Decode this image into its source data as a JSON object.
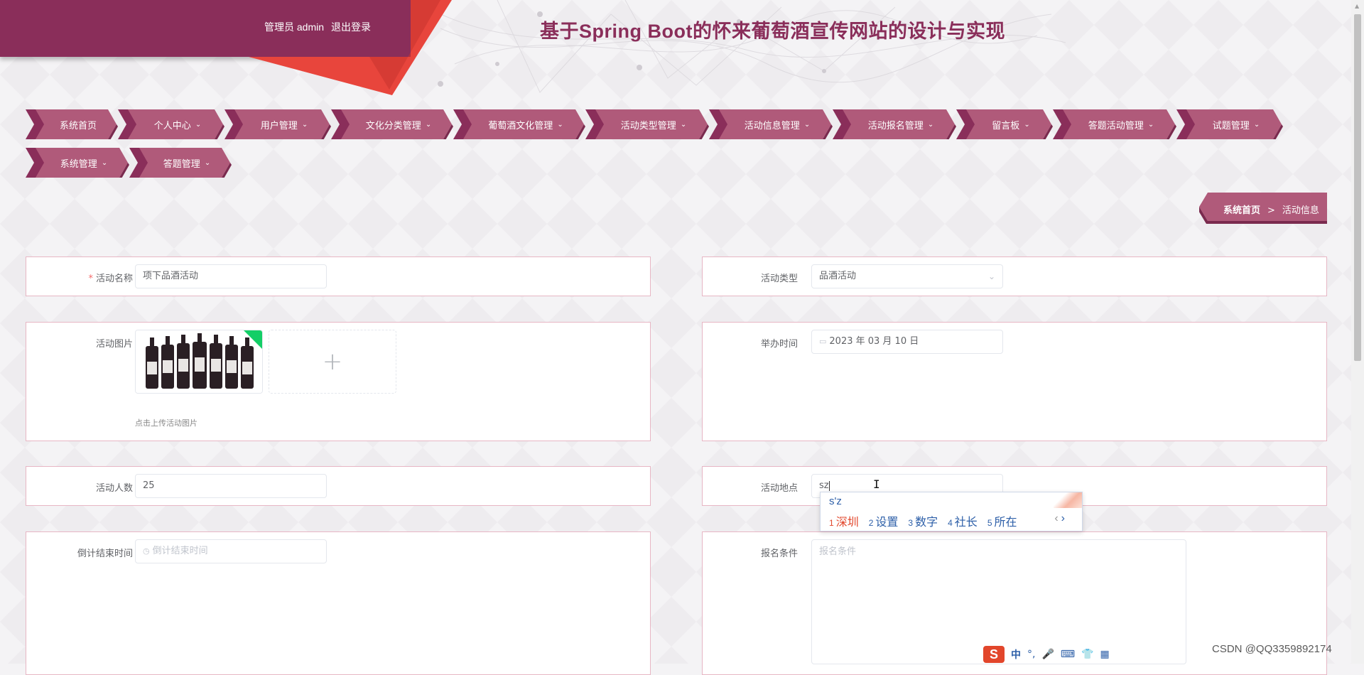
{
  "header": {
    "user_role": "管理员 admin",
    "logout_label": "退出登录",
    "site_title": "基于Spring Boot的怀来葡萄酒宣传网站的设计与实现",
    "brand_color": "#8a2e5a",
    "accent_color": "#e8453c"
  },
  "nav": {
    "items": [
      {
        "label": "系统首页",
        "chevron": ""
      },
      {
        "label": "个人中心",
        "chevron": "⌄"
      },
      {
        "label": "用户管理",
        "chevron": "⌄"
      },
      {
        "label": "文化分类管理",
        "chevron": "⌄"
      },
      {
        "label": "葡萄酒文化管理",
        "chevron": "⌄"
      },
      {
        "label": "活动类型管理",
        "chevron": "⌄"
      },
      {
        "label": "活动信息管理",
        "chevron": "⌄"
      },
      {
        "label": "活动报名管理",
        "chevron": "⌄"
      },
      {
        "label": "留言板",
        "chevron": "⌄"
      },
      {
        "label": "答题活动管理",
        "chevron": "⌄"
      },
      {
        "label": "试题管理",
        "chevron": "⌄"
      },
      {
        "label": "系统管理",
        "chevron": "⌄"
      },
      {
        "label": "答题管理",
        "chevron": "⌄"
      }
    ],
    "item_color": "#b05a7a"
  },
  "breadcrumb": {
    "home": "系统首页",
    "separator": ">",
    "current": "活动信息"
  },
  "form": {
    "required_mark": "*",
    "activity_name": {
      "label": "活动名称",
      "value": "项下品酒活动"
    },
    "activity_type": {
      "label": "活动类型",
      "value": "品酒活动"
    },
    "activity_image": {
      "label": "活动图片",
      "hint": "点击上传活动图片",
      "add_symbol": "+"
    },
    "event_time": {
      "label": "举办时间",
      "value": "2023 年 03 月 10 日"
    },
    "headcount": {
      "label": "活动人数",
      "value": "25"
    },
    "location": {
      "label": "活动地点",
      "value": "sz"
    },
    "countdown_end": {
      "label": "倒计结束时间",
      "placeholder": "倒计结束时间"
    },
    "signup_conditions": {
      "label": "报名条件",
      "placeholder": "报名条件"
    }
  },
  "ime": {
    "pinyin": "s'z",
    "candidates": [
      {
        "n": "1",
        "text": "深圳"
      },
      {
        "n": "2",
        "text": "设置"
      },
      {
        "n": "3",
        "text": "数字"
      },
      {
        "n": "4",
        "text": "社长"
      },
      {
        "n": "5",
        "text": "所在"
      }
    ],
    "prev": "‹",
    "next": "›",
    "toolbar_logo": "S",
    "toolbar_lang": "中",
    "toolbar_punct": "°,",
    "toolbar_icons": [
      "🎤",
      "⌨",
      "👕",
      "▦"
    ]
  },
  "watermark": "CSDN @QQ3359892174"
}
